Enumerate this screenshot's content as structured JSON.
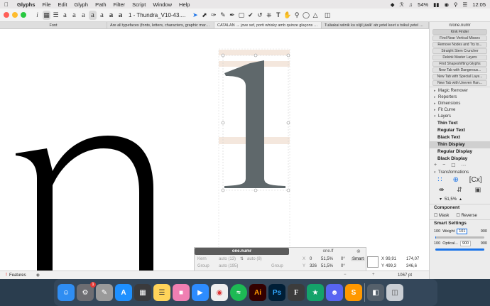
{
  "menubar": {
    "app_name": "Glyphs",
    "items": [
      "File",
      "Edit",
      "Glyph",
      "Path",
      "Filter",
      "Script",
      "Window",
      "Help"
    ],
    "battery": "54%",
    "clock": "12:05"
  },
  "toolbar": {
    "info_label": "i",
    "doc_title": "1 - Thundra_V10-43....",
    "preview_letters": [
      "a",
      "a",
      "a",
      "a",
      "a",
      "a",
      "a"
    ]
  },
  "tabs": [
    "Font",
    "Are all typefaces (fonts, letters, characters, graphic marks, sor...",
    "CATALAN → jove xef, porti whisky amb quinze glaçons d'hidro...",
    "Tulàakai wiinik ku síijil jáalk' ab yetel keet u tsikul yetel Najmal..."
  ],
  "canvas": {
    "metric_value": "1067 pt"
  },
  "infobox": {
    "glyph_left": "one.numr",
    "glyph_right": "one.lf",
    "kern_label": "Kern",
    "group_label": "Group",
    "kern_left": "auto (13)",
    "kern_right": "auto (8)",
    "group_left": "auto (195)",
    "x_label": "X",
    "y_label": "Y",
    "x_val": "0",
    "y_val": "326",
    "width_pct": "51,5%",
    "height_pct": "51,5%",
    "angle1": "0°",
    "angle2": "0°",
    "smart_label": "Smart",
    "x2": "99,91",
    "y2": "499,3",
    "w2": "174,07",
    "h2": "346,6"
  },
  "panel": {
    "glyph_name": "n/one.numr",
    "filters": [
      "Kink Finder",
      "Find Near Vertical Misses",
      "Remove Nodes and Try to...",
      "Straight Stem Cruncher",
      "Dekink Master Layers",
      "Find Shapeshifting Glyphs",
      "New Tab with Dangerous...",
      "New Tab with Special Laye...",
      "New Tab with Uneven Han..."
    ],
    "sections": [
      "Magic Remover",
      "Reporters",
      "Dimensions",
      "Fit Curve",
      "Layers"
    ],
    "layers": [
      "Thin Text",
      "Regular Text",
      "Black Text",
      "Thin Display",
      "Regular Display",
      "Black Display"
    ],
    "selected_layer": "Thin Display",
    "transformations_label": "Transformations",
    "scale_value": "51,5%",
    "component_label": "Component",
    "mask_label": "Mask",
    "reverse_label": "Reverse",
    "smart_settings_label": "Smart Settings",
    "weight_min": "100",
    "weight_label": "Weight",
    "weight_value": "101",
    "weight_max": "900",
    "optical_min": "100",
    "optical_label": "Optical...",
    "optical_value": "900",
    "optical_max": "900"
  },
  "statusbar": {
    "features_label": "Features"
  },
  "dock": {
    "badge_count": "1"
  }
}
